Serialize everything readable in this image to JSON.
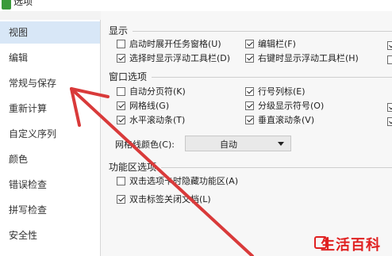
{
  "window": {
    "title": "选项"
  },
  "sidebar": {
    "items": [
      {
        "label": "视图",
        "active": true
      },
      {
        "label": "编辑",
        "active": false
      },
      {
        "label": "常规与保存",
        "active": false
      },
      {
        "label": "重新计算",
        "active": false
      },
      {
        "label": "自定义序列",
        "active": false
      },
      {
        "label": "颜色",
        "active": false
      },
      {
        "label": "错误检查",
        "active": false
      },
      {
        "label": "拼写检查",
        "active": false
      },
      {
        "label": "安全性",
        "active": false
      }
    ]
  },
  "display_section": {
    "title": "显示",
    "options": [
      {
        "label": "启动时展开任务窗格(U)",
        "checked": false
      },
      {
        "label": "编辑栏(F)",
        "checked": true
      },
      {
        "label": "选择时显示浮动工具栏(D)",
        "checked": true
      },
      {
        "label": "右键时显示浮动工具栏(H)",
        "checked": true
      }
    ]
  },
  "window_section": {
    "title": "窗口选项",
    "options": [
      {
        "label": "自动分页符(K)",
        "checked": false
      },
      {
        "label": "行号列标(E)",
        "checked": true
      },
      {
        "label": "网格线(G)",
        "checked": true
      },
      {
        "label": "分级显示符号(O)",
        "checked": true
      },
      {
        "label": "水平滚动条(T)",
        "checked": true
      },
      {
        "label": "垂直滚动条(V)",
        "checked": true
      }
    ],
    "gridline_color_label": "网格线颜色(C):",
    "gridline_color_value": "自动"
  },
  "ribbon_section": {
    "title": "功能区选项",
    "options": [
      {
        "label": "双击选项卡时隐藏功能区(A)",
        "checked": false
      },
      {
        "label": "双击标签关闭文档(L)",
        "checked": true
      }
    ]
  },
  "watermark": {
    "text": "生活百科"
  },
  "colors": {
    "arrow": "#d93a3a",
    "active_item": "#d8e7f7",
    "watermark": "#e02020"
  }
}
